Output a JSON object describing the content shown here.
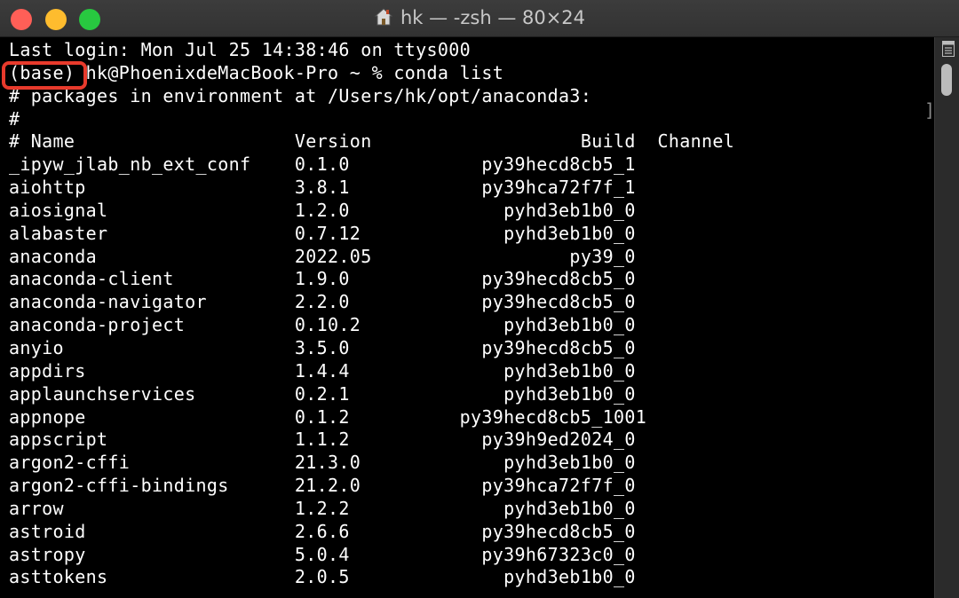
{
  "window": {
    "title": "hk — -zsh — 80×24"
  },
  "terminal": {
    "lines": [
      "Last login: Mon Jul 25 14:38:46 on ttys000",
      "(base) hk@PhoenixdeMacBook-Pro ~ % conda list",
      "# packages in environment at /Users/hk/opt/anaconda3:",
      "#",
      "# Name                    Version                   Build  Channel",
      "_ipyw_jlab_nb_ext_conf    0.1.0            py39hecd8cb5_1",
      "aiohttp                   3.8.1            py39hca72f7f_1",
      "aiosignal                 1.2.0              pyhd3eb1b0_0",
      "alabaster                 0.7.12             pyhd3eb1b0_0",
      "anaconda                  2022.05                  py39_0",
      "anaconda-client           1.9.0            py39hecd8cb5_0",
      "anaconda-navigator        2.2.0            py39hecd8cb5_0",
      "anaconda-project          0.10.2             pyhd3eb1b0_0",
      "anyio                     3.5.0            py39hecd8cb5_0",
      "appdirs                   1.4.4              pyhd3eb1b0_0",
      "applaunchservices         0.2.1              pyhd3eb1b0_0",
      "appnope                   0.1.2          py39hecd8cb5_1001",
      "appscript                 1.1.2            py39h9ed2024_0",
      "argon2-cffi               21.3.0             pyhd3eb1b0_0",
      "argon2-cffi-bindings      21.2.0           py39hca72f7f_0",
      "arrow                     1.2.2              pyhd3eb1b0_0",
      "astroid                   2.6.6            py39hecd8cb5_0",
      "astropy                   5.0.4            py39h67323c0_0",
      "asttokens                 2.0.5              pyhd3eb1b0_0"
    ],
    "side_bracket": "]"
  },
  "colors": {
    "highlight": "#e83a2c"
  }
}
